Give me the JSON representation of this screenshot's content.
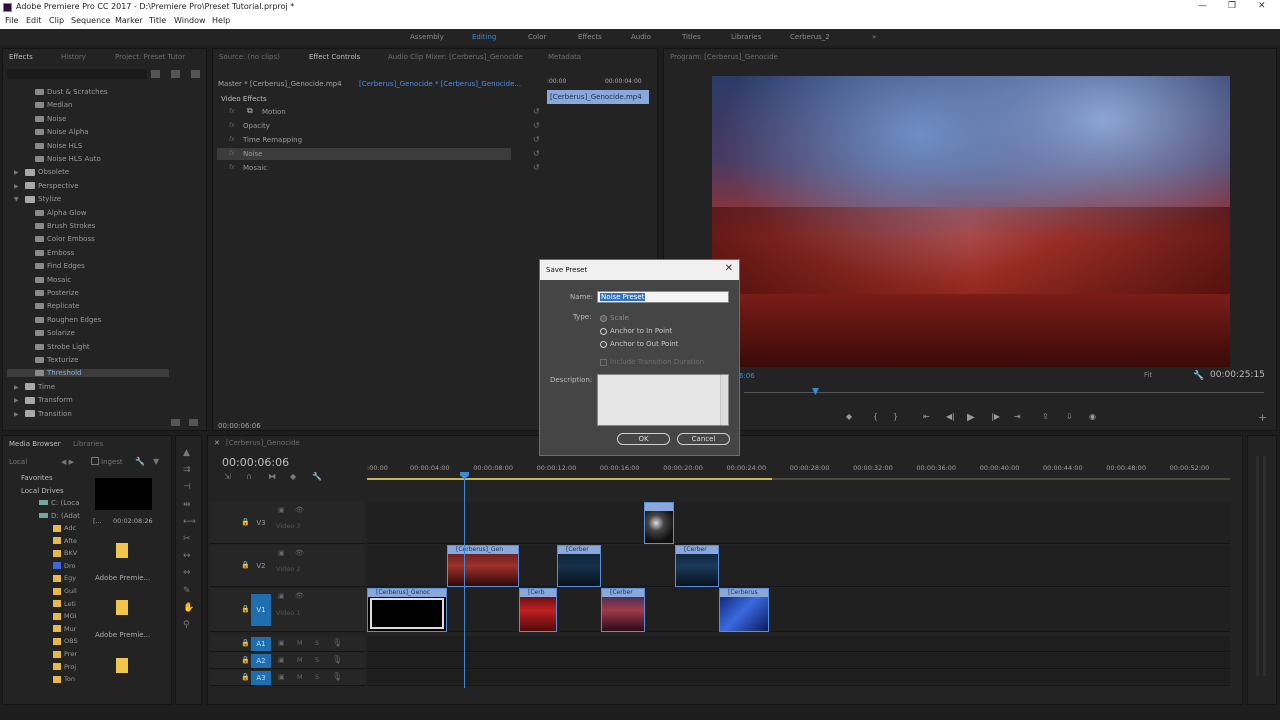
{
  "window": {
    "title": "Adobe Premiere Pro CC 2017 - D:\\Premiere Pro\\Preset Tutorial.prproj *",
    "minimize": "—",
    "maximize": "❐",
    "close": "✕"
  },
  "menu": [
    "File",
    "Edit",
    "Clip",
    "Sequence",
    "Marker",
    "Title",
    "Window",
    "Help"
  ],
  "workspaces": [
    "Assembly",
    "Editing",
    "Color",
    "Effects",
    "Audio",
    "Titles",
    "Libraries",
    "Cerberus_2"
  ],
  "workspace_more": "»",
  "effects_panel": {
    "tabs": [
      "Effects",
      "History",
      "Project: Preset Tutor"
    ],
    "items": [
      {
        "label": "Dust & Scratches",
        "kind": "fx"
      },
      {
        "label": "Median",
        "kind": "fx"
      },
      {
        "label": "Noise",
        "kind": "fx"
      },
      {
        "label": "Noise Alpha",
        "kind": "fx"
      },
      {
        "label": "Noise HLS",
        "kind": "fx"
      },
      {
        "label": "Noise HLS Auto",
        "kind": "fx"
      },
      {
        "label": "Obsolete",
        "kind": "folder"
      },
      {
        "label": "Perspective",
        "kind": "folder"
      },
      {
        "label": "Stylize",
        "kind": "folder-open"
      },
      {
        "label": "Alpha Glow",
        "kind": "fx"
      },
      {
        "label": "Brush Strokes",
        "kind": "fx"
      },
      {
        "label": "Color Emboss",
        "kind": "fx"
      },
      {
        "label": "Emboss",
        "kind": "fx"
      },
      {
        "label": "Find Edges",
        "kind": "fx"
      },
      {
        "label": "Mosaic",
        "kind": "fx"
      },
      {
        "label": "Posterize",
        "kind": "fx"
      },
      {
        "label": "Replicate",
        "kind": "fx"
      },
      {
        "label": "Roughen Edges",
        "kind": "fx"
      },
      {
        "label": "Solarize",
        "kind": "fx"
      },
      {
        "label": "Strobe Light",
        "kind": "fx"
      },
      {
        "label": "Texturize",
        "kind": "fx"
      },
      {
        "label": "Threshold",
        "kind": "fx-selected"
      },
      {
        "label": "Time",
        "kind": "folder"
      },
      {
        "label": "Transform",
        "kind": "folder"
      },
      {
        "label": "Transition",
        "kind": "folder"
      }
    ]
  },
  "effect_controls": {
    "tabs": [
      "Source: (no clips)",
      "Effect Controls",
      "Audio Clip Mixer: [Cerberus]_Genocide",
      "Metadata"
    ],
    "master": "Master * [Cerberus]_Genocide.mp4",
    "sequence_clip": "[Cerberus]_Genocide * [Cerberus]_Genocide...",
    "mini_times": [
      ":00:00",
      "00:00:04:00"
    ],
    "mini_clip": "[Cerberus]_Genocide.mp4",
    "section": "Video Effects",
    "effects": [
      "Motion",
      "Opacity",
      "Time Remapping",
      "Noise",
      "Mosaic"
    ],
    "current_time": "00:00:06:06"
  },
  "program_monitor": {
    "tab": "Program: [Cerberus]_Genocide",
    "fit": "Fit",
    "timecode_left": "00:00:06:06",
    "timecode": "00:00:25:15",
    "controls": [
      "marker-icon",
      "in-icon",
      "out-icon",
      "go-in-icon",
      "step-back-icon",
      "play-icon",
      "step-forward-icon",
      "go-out-icon",
      "lift-icon",
      "extract-icon",
      "camera-icon"
    ]
  },
  "dialog": {
    "title": "Save Preset",
    "close": "✕",
    "name_label": "Name:",
    "name_value": "Noise Preset",
    "type_label": "Type:",
    "types": [
      "Scale",
      "Anchor to In Point",
      "Anchor to Out Point"
    ],
    "include_transition": "Include Transition Duration",
    "description_label": "Description:",
    "ok": "OK",
    "cancel": "Cancel"
  },
  "media_browser": {
    "tabs": [
      "Media Browser",
      "Libraries"
    ],
    "local": "Local",
    "ingest": "Ingest",
    "favorites": "Favorites",
    "local_drives": "Local Drives",
    "drives": [
      "C: (Loca",
      "D: (Adat"
    ],
    "folders": [
      "Adc",
      "Afte",
      "BKV",
      "Dro",
      "Egy",
      "Guil",
      "Leti",
      "MGI",
      "Mur",
      "OBS",
      "Prer",
      "Proj",
      "Ton"
    ],
    "thumbs": [
      {
        "label": "[...",
        "duration": "00:02:08:26"
      },
      {
        "label": "Adobe Premie..."
      },
      {
        "label": "Adobe Premie..."
      }
    ]
  },
  "timeline": {
    "tab": "[Cerberus]_Genocide",
    "timecode": "00:00:06:06",
    "ruler": [
      ":00:00",
      "00:00:04:00",
      "00:00:08:00",
      "00:00:12:00",
      "00:00:16:00",
      "00:00:20:00",
      "00:00:24:00",
      "00:00:28:00",
      "00:00:32:00",
      "00:00:36:00",
      "00:00:40:00",
      "00:00:44:00",
      "00:00:48:00",
      "00:00:52:00"
    ],
    "tracks": [
      {
        "id": "V3",
        "name": "Video 3"
      },
      {
        "id": "V2",
        "name": "Video 2"
      },
      {
        "id": "V1",
        "name": "Video 1"
      },
      {
        "id": "A1",
        "name": ""
      },
      {
        "id": "A2",
        "name": ""
      },
      {
        "id": "A3",
        "name": ""
      }
    ],
    "track_letters": [
      "M",
      "S"
    ],
    "clips": {
      "v2a": "[Cerberus]_Gen",
      "v2b": "[Cerber",
      "v2c": "[Cerber",
      "v1a": "[Cerberus]_Genoc",
      "v1b": "[Cerb",
      "v1c": "[Cerber",
      "v1d": "[Cerberus"
    }
  },
  "colors": {
    "accent": "#3b8bd6",
    "panel": "#232323",
    "clip": "#8aa8dc"
  }
}
